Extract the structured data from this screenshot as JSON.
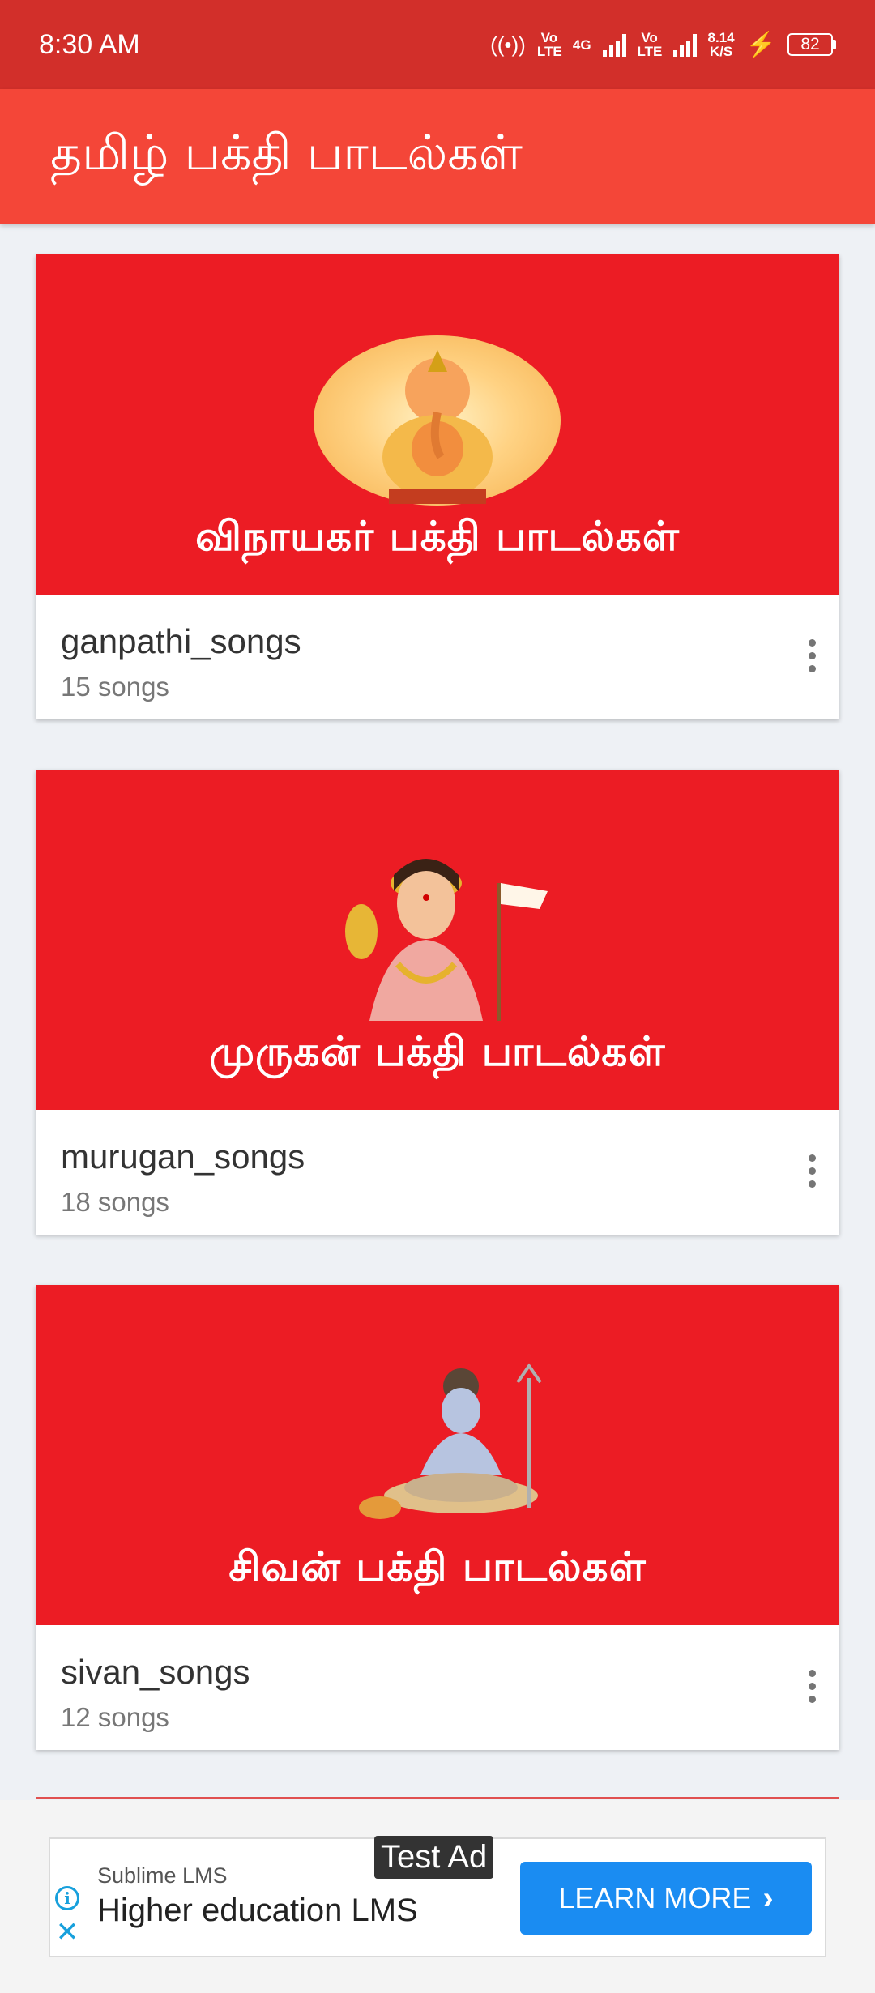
{
  "status_bar": {
    "time": "8:30 AM",
    "network1": "Vo LTE",
    "network2": "4G",
    "network3": "Vo LTE",
    "speed_value": "8.14",
    "speed_unit": "K/S",
    "battery": "82"
  },
  "app_bar": {
    "title": "தமிழ் பக்தி பாடல்கள்"
  },
  "albums": [
    {
      "banner_text": "விநாயகர் பக்தி பாடல்கள்",
      "title": "ganpathi_songs",
      "count": "15 songs"
    },
    {
      "banner_text": "முருகன் பக்தி பாடல்கள்",
      "title": "murugan_songs",
      "count": "18 songs"
    },
    {
      "banner_text": "சிவன் பக்தி பாடல்கள்",
      "title": "sivan_songs",
      "count": "12 songs"
    }
  ],
  "ad": {
    "tag": "Test Ad",
    "advertiser": "Sublime LMS",
    "headline": "Higher education LMS",
    "cta_label": "LEARN MORE",
    "info_icon": "info-icon",
    "close_icon": "close-icon"
  },
  "colors": {
    "status_bar": "#d22f2a",
    "app_bar": "#f44638",
    "banner": "#ec1c24",
    "cta": "#1a8cf2"
  }
}
